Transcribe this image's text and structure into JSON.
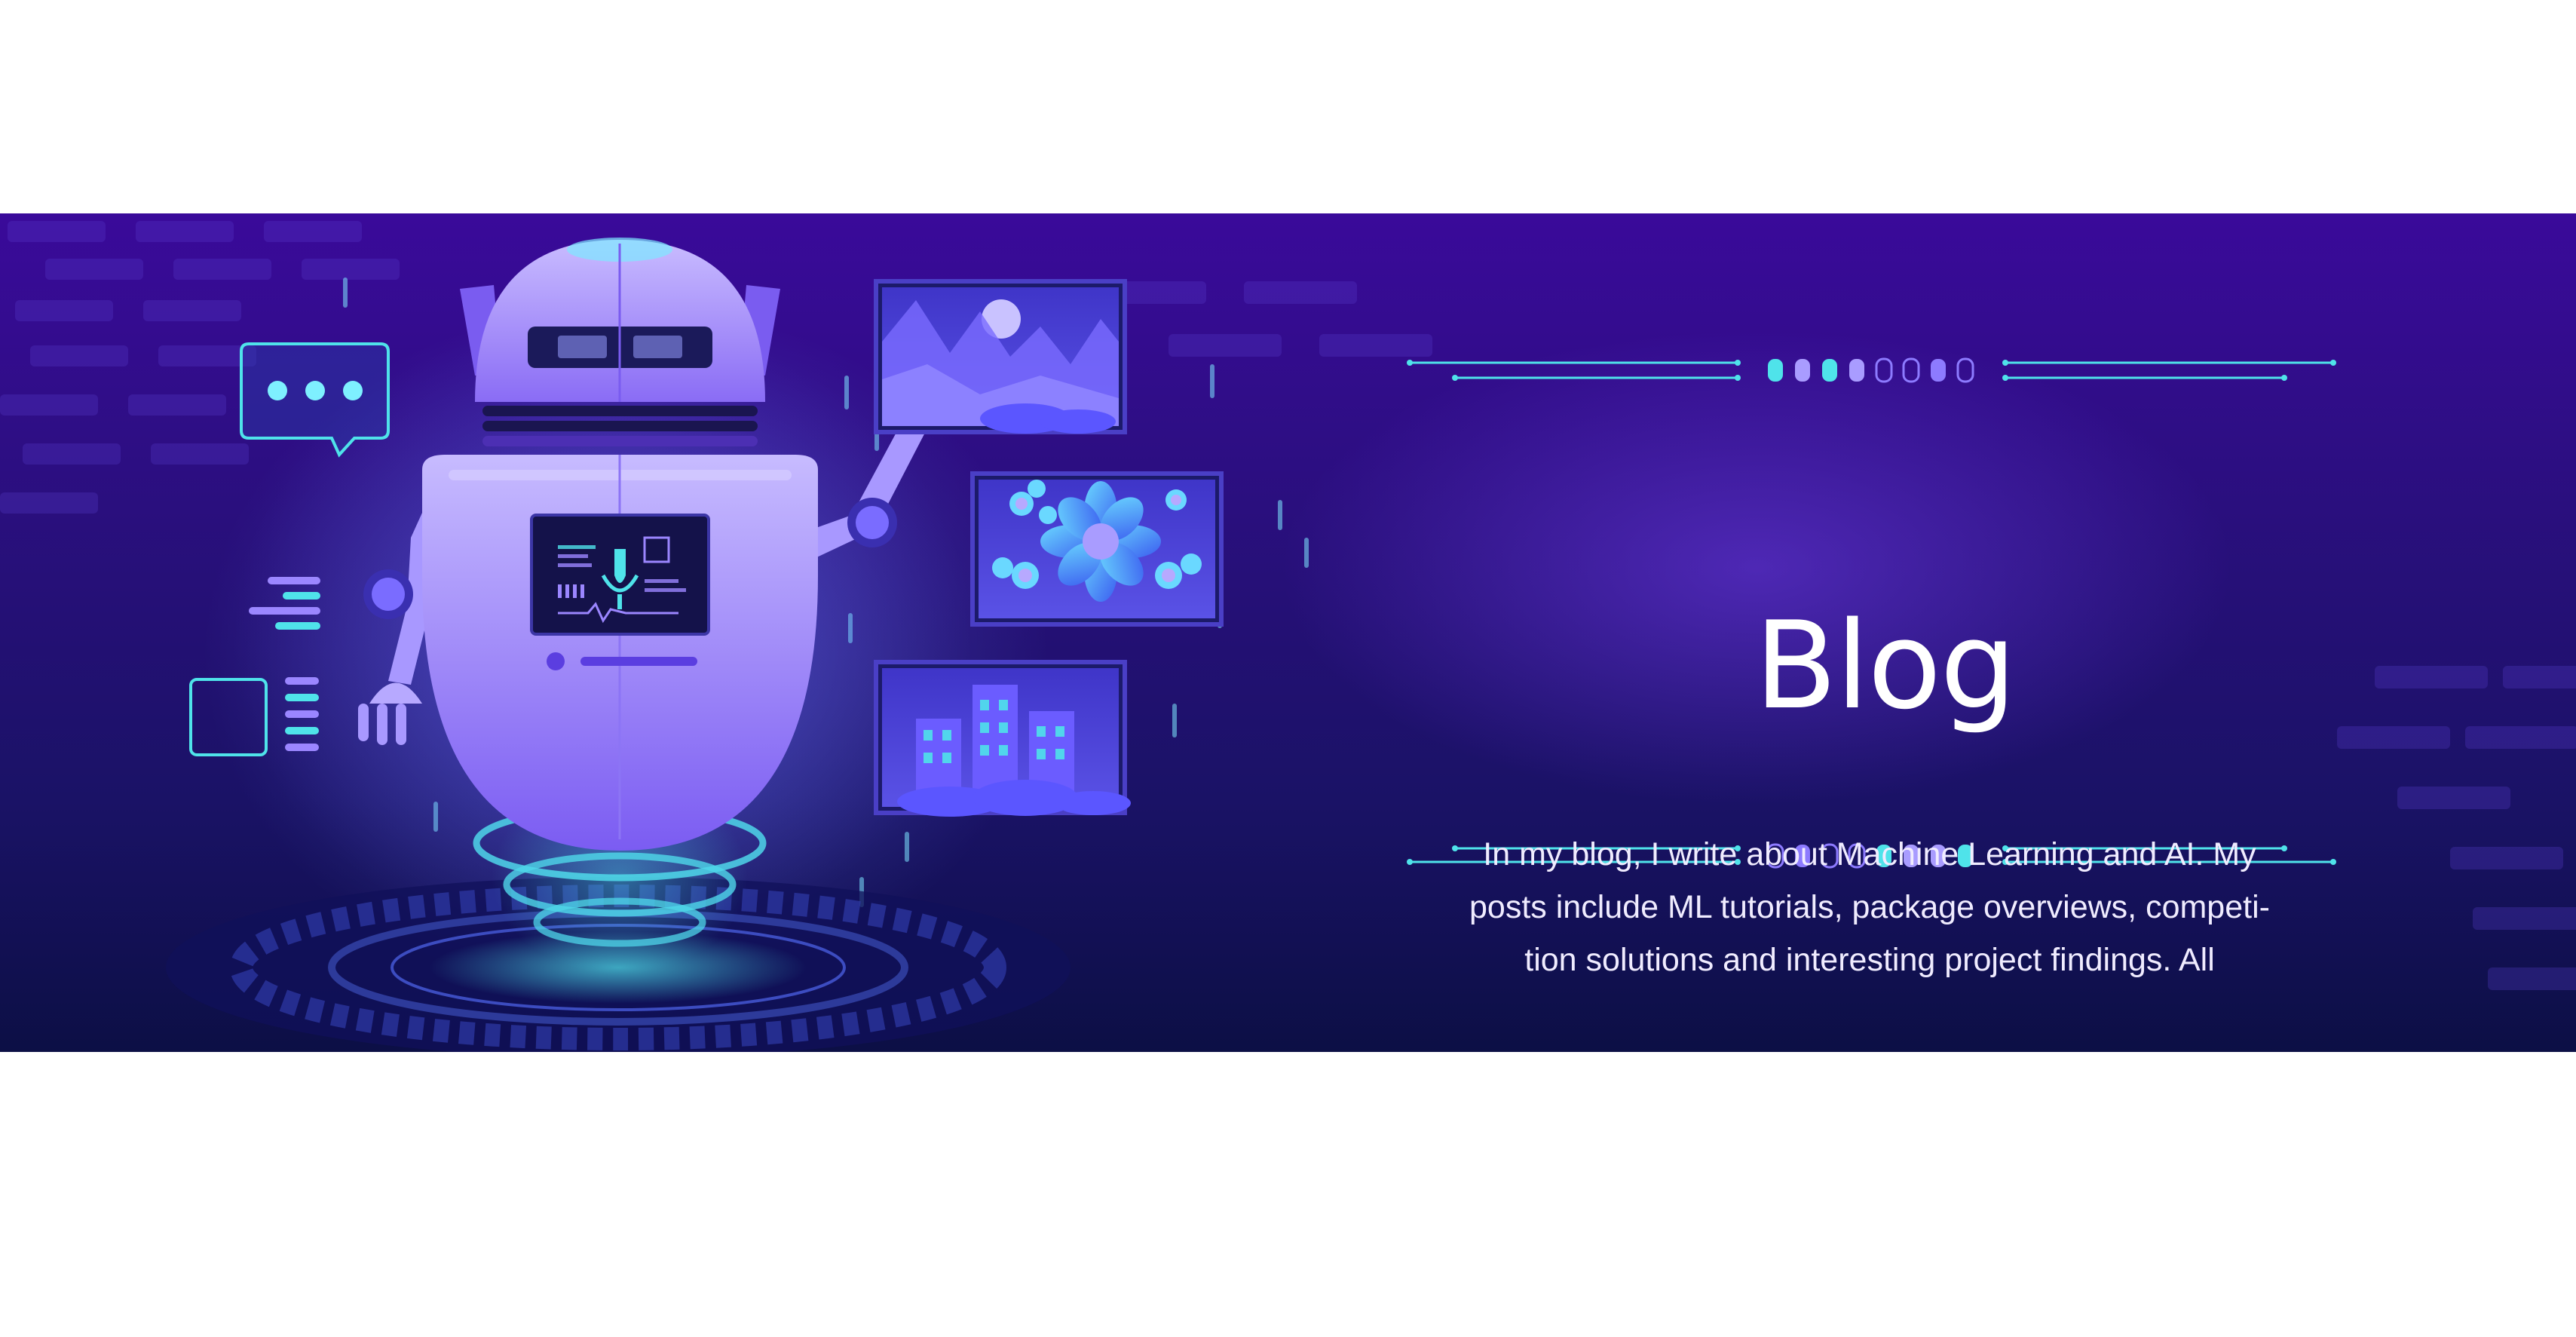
{
  "banner": {
    "title": "Blog",
    "description": "In my blog, I write about Machine Learning and AI. My posts include ML tutorials, package overviews, competi-tion solutions and interesting project findings. All"
  },
  "colors": {
    "page_background": "#ffffff",
    "banner_top": "#3a0a9a",
    "banner_bottom": "#0c0f45",
    "accent_cyan": "#4fe3ea",
    "accent_violet": "#9b86ff",
    "text": "#ffffff"
  },
  "icons": [
    "robot-illustration",
    "chat-bubble-icon",
    "landscape-image-icon",
    "flowers-image-icon",
    "city-image-icon",
    "hologram-platform-icon",
    "menu-lines-icon",
    "checkbox-list-icon"
  ]
}
